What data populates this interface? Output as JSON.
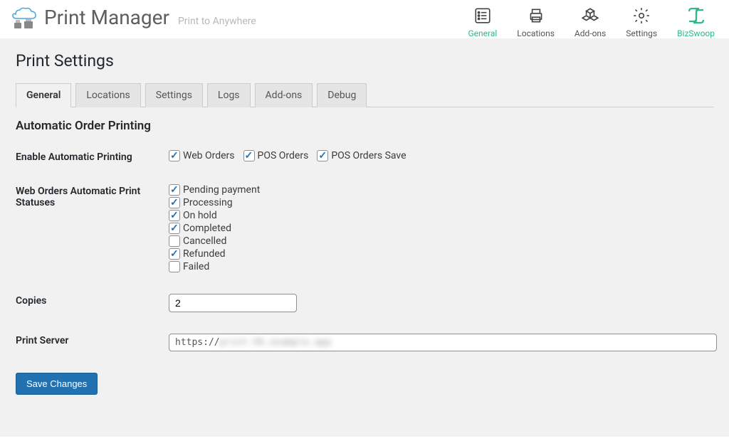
{
  "header": {
    "title": "Print Manager",
    "subtitle": "Print to Anywhere",
    "nav": [
      {
        "label": "General",
        "icon": "list-icon",
        "active": true
      },
      {
        "label": "Locations",
        "icon": "printer-icon",
        "active": false
      },
      {
        "label": "Add-ons",
        "icon": "cubes-icon",
        "active": false
      },
      {
        "label": "Settings",
        "icon": "gear-icon",
        "active": false
      },
      {
        "label": "BizSwoop",
        "icon": "bizswoop-icon",
        "active": false
      }
    ]
  },
  "page": {
    "title": "Print Settings",
    "tabs": [
      "General",
      "Locations",
      "Settings",
      "Logs",
      "Add-ons",
      "Debug"
    ],
    "active_tab": "General",
    "section_title": "Automatic Order Printing",
    "rows": {
      "enable_label": "Enable Automatic Printing",
      "enable_options": [
        {
          "label": "Web Orders",
          "checked": true
        },
        {
          "label": "POS Orders",
          "checked": true
        },
        {
          "label": "POS Orders Save",
          "checked": true
        }
      ],
      "statuses_label": "Web Orders Automatic Print Statuses",
      "statuses": [
        {
          "label": "Pending payment",
          "checked": true
        },
        {
          "label": "Processing",
          "checked": true
        },
        {
          "label": "On hold",
          "checked": true
        },
        {
          "label": "Completed",
          "checked": true
        },
        {
          "label": "Cancelled",
          "checked": false
        },
        {
          "label": "Refunded",
          "checked": true
        },
        {
          "label": "Failed",
          "checked": false
        }
      ],
      "copies_label": "Copies",
      "copies_value": "2",
      "server_label": "Print Server",
      "server_value": "https://"
    },
    "save_button": "Save Changes"
  }
}
